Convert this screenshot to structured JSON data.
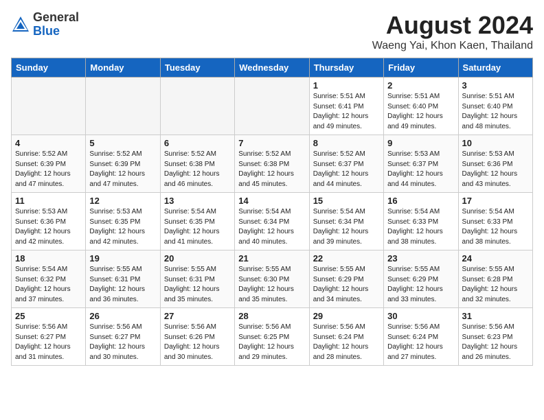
{
  "header": {
    "logo_general": "General",
    "logo_blue": "Blue",
    "month_title": "August 2024",
    "location": "Waeng Yai, Khon Kaen, Thailand"
  },
  "days_of_week": [
    "Sunday",
    "Monday",
    "Tuesday",
    "Wednesday",
    "Thursday",
    "Friday",
    "Saturday"
  ],
  "weeks": [
    [
      {
        "day": "",
        "info": ""
      },
      {
        "day": "",
        "info": ""
      },
      {
        "day": "",
        "info": ""
      },
      {
        "day": "",
        "info": ""
      },
      {
        "day": "1",
        "info": "Sunrise: 5:51 AM\nSunset: 6:41 PM\nDaylight: 12 hours\nand 49 minutes."
      },
      {
        "day": "2",
        "info": "Sunrise: 5:51 AM\nSunset: 6:40 PM\nDaylight: 12 hours\nand 49 minutes."
      },
      {
        "day": "3",
        "info": "Sunrise: 5:51 AM\nSunset: 6:40 PM\nDaylight: 12 hours\nand 48 minutes."
      }
    ],
    [
      {
        "day": "4",
        "info": "Sunrise: 5:52 AM\nSunset: 6:39 PM\nDaylight: 12 hours\nand 47 minutes."
      },
      {
        "day": "5",
        "info": "Sunrise: 5:52 AM\nSunset: 6:39 PM\nDaylight: 12 hours\nand 47 minutes."
      },
      {
        "day": "6",
        "info": "Sunrise: 5:52 AM\nSunset: 6:38 PM\nDaylight: 12 hours\nand 46 minutes."
      },
      {
        "day": "7",
        "info": "Sunrise: 5:52 AM\nSunset: 6:38 PM\nDaylight: 12 hours\nand 45 minutes."
      },
      {
        "day": "8",
        "info": "Sunrise: 5:52 AM\nSunset: 6:37 PM\nDaylight: 12 hours\nand 44 minutes."
      },
      {
        "day": "9",
        "info": "Sunrise: 5:53 AM\nSunset: 6:37 PM\nDaylight: 12 hours\nand 44 minutes."
      },
      {
        "day": "10",
        "info": "Sunrise: 5:53 AM\nSunset: 6:36 PM\nDaylight: 12 hours\nand 43 minutes."
      }
    ],
    [
      {
        "day": "11",
        "info": "Sunrise: 5:53 AM\nSunset: 6:36 PM\nDaylight: 12 hours\nand 42 minutes."
      },
      {
        "day": "12",
        "info": "Sunrise: 5:53 AM\nSunset: 6:35 PM\nDaylight: 12 hours\nand 42 minutes."
      },
      {
        "day": "13",
        "info": "Sunrise: 5:54 AM\nSunset: 6:35 PM\nDaylight: 12 hours\nand 41 minutes."
      },
      {
        "day": "14",
        "info": "Sunrise: 5:54 AM\nSunset: 6:34 PM\nDaylight: 12 hours\nand 40 minutes."
      },
      {
        "day": "15",
        "info": "Sunrise: 5:54 AM\nSunset: 6:34 PM\nDaylight: 12 hours\nand 39 minutes."
      },
      {
        "day": "16",
        "info": "Sunrise: 5:54 AM\nSunset: 6:33 PM\nDaylight: 12 hours\nand 38 minutes."
      },
      {
        "day": "17",
        "info": "Sunrise: 5:54 AM\nSunset: 6:33 PM\nDaylight: 12 hours\nand 38 minutes."
      }
    ],
    [
      {
        "day": "18",
        "info": "Sunrise: 5:54 AM\nSunset: 6:32 PM\nDaylight: 12 hours\nand 37 minutes."
      },
      {
        "day": "19",
        "info": "Sunrise: 5:55 AM\nSunset: 6:31 PM\nDaylight: 12 hours\nand 36 minutes."
      },
      {
        "day": "20",
        "info": "Sunrise: 5:55 AM\nSunset: 6:31 PM\nDaylight: 12 hours\nand 35 minutes."
      },
      {
        "day": "21",
        "info": "Sunrise: 5:55 AM\nSunset: 6:30 PM\nDaylight: 12 hours\nand 35 minutes."
      },
      {
        "day": "22",
        "info": "Sunrise: 5:55 AM\nSunset: 6:29 PM\nDaylight: 12 hours\nand 34 minutes."
      },
      {
        "day": "23",
        "info": "Sunrise: 5:55 AM\nSunset: 6:29 PM\nDaylight: 12 hours\nand 33 minutes."
      },
      {
        "day": "24",
        "info": "Sunrise: 5:55 AM\nSunset: 6:28 PM\nDaylight: 12 hours\nand 32 minutes."
      }
    ],
    [
      {
        "day": "25",
        "info": "Sunrise: 5:56 AM\nSunset: 6:27 PM\nDaylight: 12 hours\nand 31 minutes."
      },
      {
        "day": "26",
        "info": "Sunrise: 5:56 AM\nSunset: 6:27 PM\nDaylight: 12 hours\nand 30 minutes."
      },
      {
        "day": "27",
        "info": "Sunrise: 5:56 AM\nSunset: 6:26 PM\nDaylight: 12 hours\nand 30 minutes."
      },
      {
        "day": "28",
        "info": "Sunrise: 5:56 AM\nSunset: 6:25 PM\nDaylight: 12 hours\nand 29 minutes."
      },
      {
        "day": "29",
        "info": "Sunrise: 5:56 AM\nSunset: 6:24 PM\nDaylight: 12 hours\nand 28 minutes."
      },
      {
        "day": "30",
        "info": "Sunrise: 5:56 AM\nSunset: 6:24 PM\nDaylight: 12 hours\nand 27 minutes."
      },
      {
        "day": "31",
        "info": "Sunrise: 5:56 AM\nSunset: 6:23 PM\nDaylight: 12 hours\nand 26 minutes."
      }
    ]
  ]
}
